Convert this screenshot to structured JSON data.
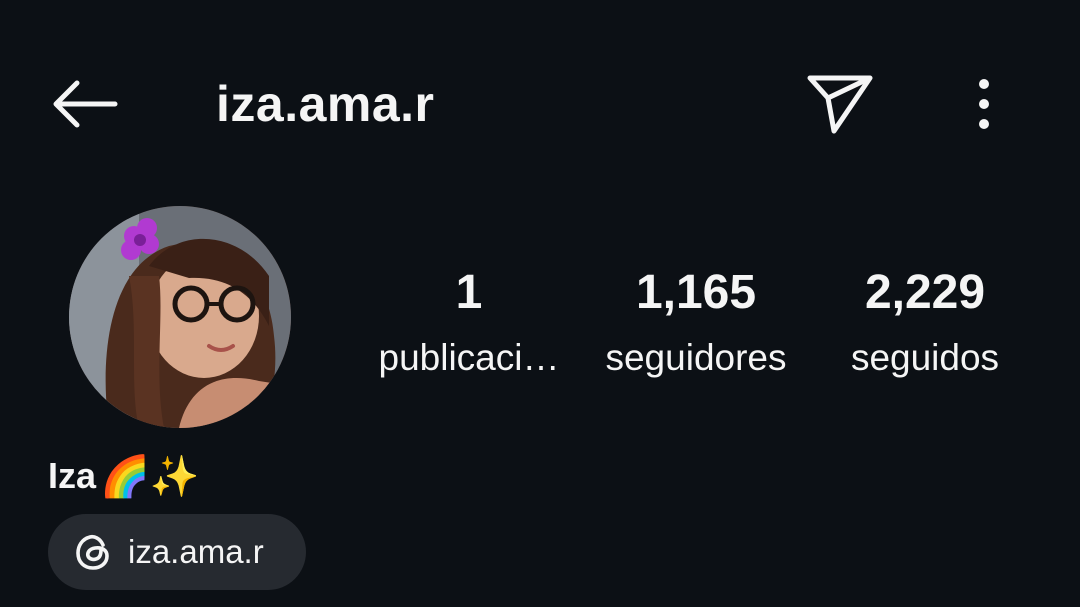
{
  "header": {
    "username": "iza.ama.r",
    "icons": {
      "back": "arrow-left-icon",
      "send": "send-icon",
      "more": "more-vertical-icon"
    }
  },
  "profile": {
    "avatar": "profile-photo",
    "display_name": "Iza",
    "display_name_emoji": "🌈✨",
    "stats": {
      "posts": {
        "value": "1",
        "label": "publicaci…"
      },
      "followers": {
        "value": "1,165",
        "label": "seguidores"
      },
      "following": {
        "value": "2,229",
        "label": "seguidos"
      }
    },
    "threads": {
      "icon": "threads-icon",
      "handle": "iza.ama.r"
    }
  },
  "colors": {
    "background": "#0c1015",
    "text": "#f5f5f5",
    "chip": "#262a30"
  }
}
